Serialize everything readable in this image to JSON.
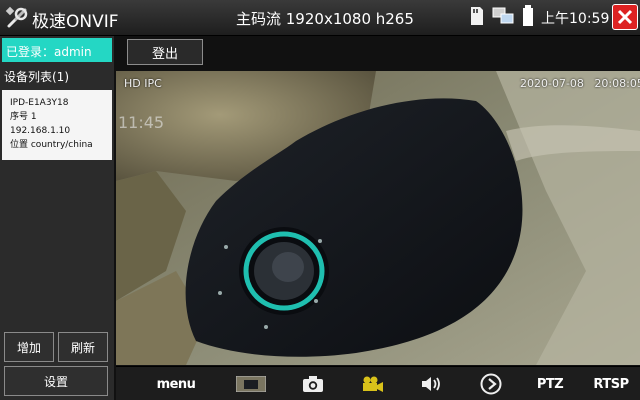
{
  "app": {
    "title": "极速ONVIF"
  },
  "header": {
    "stream_info": "主码流 1920x1080 h265",
    "clock": "上午10:59"
  },
  "sidebar": {
    "login_status": "已登录：admin",
    "device_list_header": "设备列表(1)",
    "device": {
      "name": "IPD-E1A3Y18",
      "serial": "序号 1",
      "ip": "192.168.1.10",
      "location": "位置 country/china"
    },
    "add_label": "增加",
    "refresh_label": "刷新",
    "settings_label": "设置"
  },
  "main": {
    "logout_label": "登出"
  },
  "video": {
    "osd_left": "HD IPC",
    "osd_datetime": "2020-07-08   20:08:05",
    "osd_time": "11:45"
  },
  "toolbar": {
    "menu_label": "menu",
    "ptz_label": "PTZ",
    "rtsp_label": "RTSP"
  },
  "colors": {
    "accent": "#24d7c4",
    "close": "#dd2222",
    "record": "#d9c21a"
  }
}
